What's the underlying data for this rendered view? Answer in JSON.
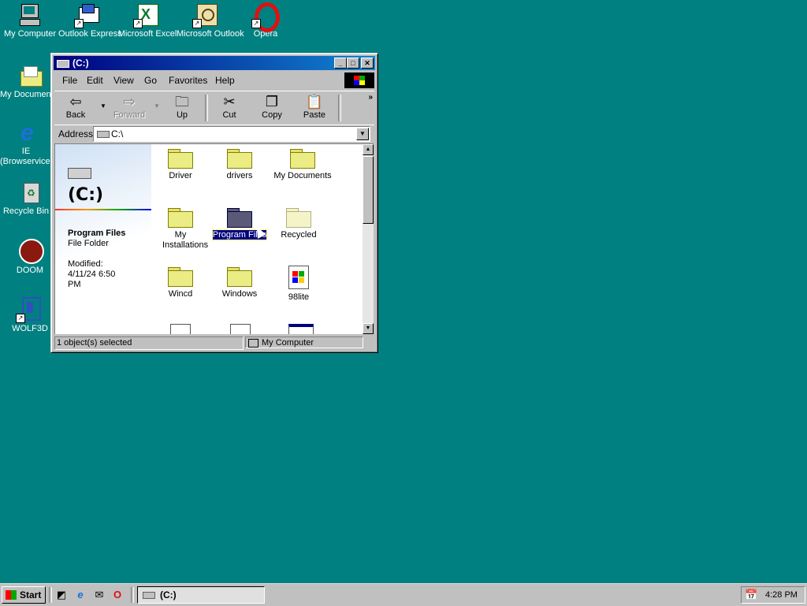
{
  "desktop": {
    "icons": [
      {
        "label": "My Computer",
        "icon": "my-computer-icon"
      },
      {
        "label": "Outlook Express",
        "icon": "outlook-express-icon"
      },
      {
        "label": "Microsoft Excel",
        "icon": "excel-icon"
      },
      {
        "label": "Microsoft Outlook",
        "icon": "outlook-icon"
      },
      {
        "label": "Opera",
        "icon": "opera-icon"
      },
      {
        "label": "My Documents",
        "icon": "my-documents-icon"
      },
      {
        "label": "IE (Browservice)",
        "icon": "ie-icon"
      },
      {
        "label": "Recycle Bin",
        "icon": "recycle-bin-icon"
      },
      {
        "label": "DOOM",
        "icon": "doom-icon"
      },
      {
        "label": "WOLF3D",
        "icon": "wolf3d-icon"
      }
    ]
  },
  "window": {
    "title": "(C:)",
    "menu": [
      "File",
      "Edit",
      "View",
      "Go",
      "Favorites",
      "Help"
    ],
    "toolbar": {
      "back": "Back",
      "forward": "Forward",
      "up": "Up",
      "cut": "Cut",
      "copy": "Copy",
      "paste": "Paste"
    },
    "address": {
      "label": "Address",
      "value": "C:\\"
    },
    "panel": {
      "drive_title": "(C:)",
      "selected_name": "Program Files",
      "selected_type": "File Folder",
      "modified_label": "Modified:",
      "modified_date": "4/11/24 6:50",
      "modified_time": "PM"
    },
    "files": [
      {
        "label": "Driver"
      },
      {
        "label": "drivers"
      },
      {
        "label": "My Documents"
      },
      {
        "label": "My Installations"
      },
      {
        "label": "Program Files"
      },
      {
        "label": "Recycled"
      },
      {
        "label": "Wincd"
      },
      {
        "label": "Windows"
      },
      {
        "label": "98lite"
      }
    ],
    "status": {
      "left": "1 object(s) selected",
      "right": "My Computer"
    }
  },
  "taskbar": {
    "start": "Start",
    "task": "(C:)",
    "clock": "4:28 PM"
  },
  "colors": {
    "desktop": "#008080",
    "titlebar": "#000080",
    "selection": "#000080"
  }
}
